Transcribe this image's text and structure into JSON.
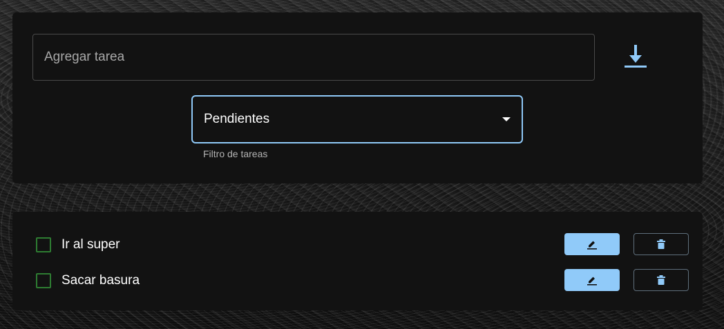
{
  "new_task": {
    "placeholder": "Agregar tarea",
    "value": "",
    "save_icon": "download-icon"
  },
  "filter": {
    "selected": "Pendientes",
    "helper_text": "Filtro de tareas",
    "arrow_icon": "dropdown-arrow-icon"
  },
  "tasks": [
    {
      "label": "Ir al super",
      "checked": false,
      "edit_icon": "pencil-icon",
      "delete_icon": "trash-icon"
    },
    {
      "label": "Sacar basura",
      "checked": false,
      "edit_icon": "pencil-icon",
      "delete_icon": "trash-icon"
    }
  ],
  "colors": {
    "accent": "#90caf9",
    "checkbox_border": "#2e7d32",
    "card_background": "#121212",
    "text": "#ffffff"
  }
}
